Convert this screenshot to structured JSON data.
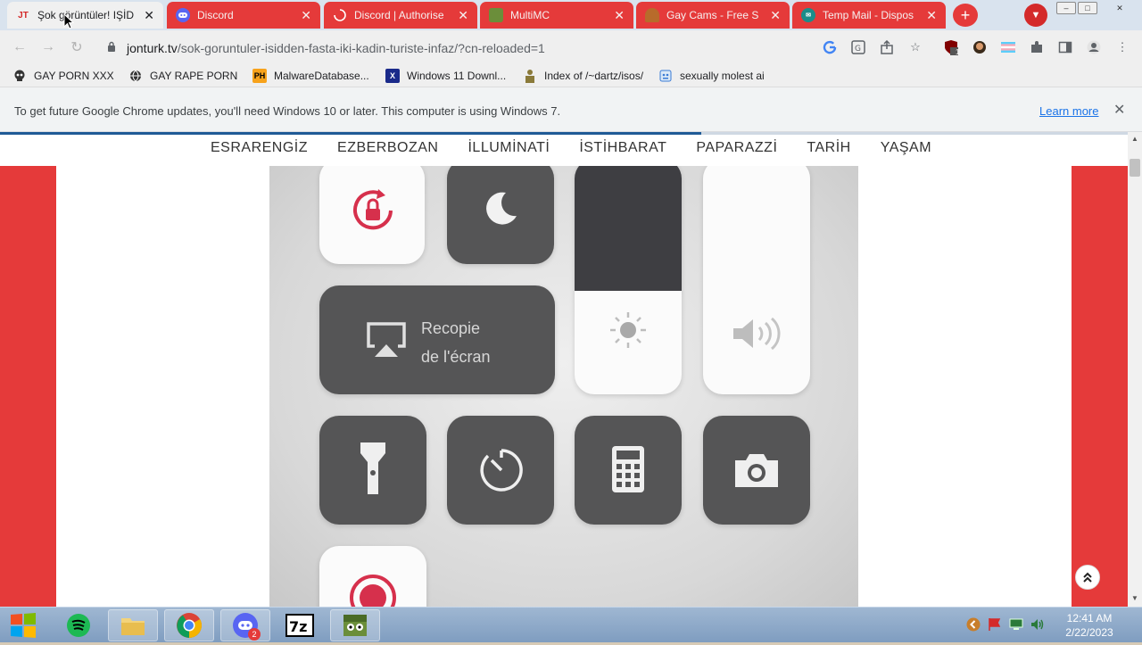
{
  "tabs": [
    {
      "title": "Şok görüntüler! IŞİD",
      "favicon": "JT",
      "active": true
    },
    {
      "title": "Discord",
      "favicon": "discord-icon",
      "active": false
    },
    {
      "title": "Discord | Authorise",
      "favicon": "loading-icon",
      "active": false
    },
    {
      "title": "MultiMC",
      "favicon": "multimc-icon",
      "active": false
    },
    {
      "title": "Gay Cams - Free S",
      "favicon": "cams-icon",
      "active": false
    },
    {
      "title": "Temp Mail - Dispos",
      "favicon": "tempmail-icon",
      "active": false
    }
  ],
  "toolbar": {
    "url_host": "jonturk.tv",
    "url_path": "/sok-goruntuler-isidden-fasta-iki-kadin-turiste-infaz/?cn-reloaded=1"
  },
  "bookmarks": [
    {
      "label": "GAY PORN XXX",
      "icon": "skull-icon"
    },
    {
      "label": "GAY RAPE PORN",
      "icon": "globe-icon"
    },
    {
      "label": "MalwareDatabase...",
      "icon": "PH"
    },
    {
      "label": "Windows 11 Downl...",
      "icon": "X"
    },
    {
      "label": "Index of /~dartz/isos/",
      "icon": "folder-person-icon"
    },
    {
      "label": "sexually molest ai",
      "icon": "robot-icon"
    }
  ],
  "infobar": {
    "message": "To get future Google Chrome updates, you'll need Windows 10 or later. This computer is using Windows 7.",
    "link": "Learn more"
  },
  "site_nav": [
    "ESRARENGİZ",
    "EZBERBOZAN",
    "İLLUMİNATİ",
    "İSTİHBARAT",
    "PAPARAZZİ",
    "TARİH",
    "YAŞAM"
  ],
  "photo": {
    "screen_mirroring_line1": "Recopie",
    "screen_mirroring_line2": "de l'écran"
  },
  "taskbar": {
    "badge_count": "2",
    "time": "12:41 AM",
    "date": "2/22/2023"
  },
  "extension_badge": "1",
  "colors": {
    "tab_red": "#e53a3a",
    "page_red": "#e53a3a",
    "nav_blue": "#1f5a96",
    "link_blue": "#1a73e8"
  }
}
